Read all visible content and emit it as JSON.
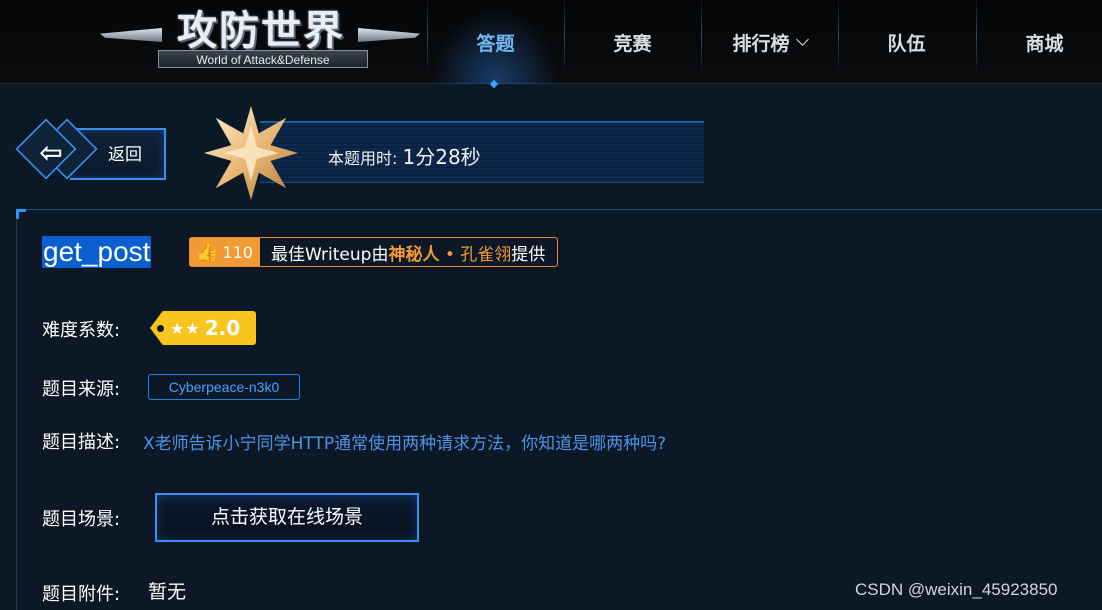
{
  "brand": {
    "logo_main": "攻防世界",
    "logo_sub": "World of Attack&Defense"
  },
  "nav": {
    "items": [
      {
        "label": "答题",
        "active": true
      },
      {
        "label": "竞赛",
        "active": false
      },
      {
        "label": "排行榜",
        "active": false,
        "has_dropdown": true
      },
      {
        "label": "队伍",
        "active": false
      },
      {
        "label": "商城",
        "active": false
      }
    ]
  },
  "back": {
    "label": "返回",
    "icon": "arrow-left-icon"
  },
  "timer": {
    "label": "本题用时:",
    "value": "1分28秒"
  },
  "challenge": {
    "title": "get_post",
    "writeup": {
      "likes": "110",
      "prefix": "最佳Writeup由",
      "author": "神秘人",
      "separator": "•",
      "translator": "孔雀翎",
      "suffix": "提供"
    },
    "difficulty": {
      "label": "难度系数:",
      "stars": "★★",
      "value": "2.0"
    },
    "source": {
      "label": "题目来源:",
      "value": "Cyberpeace-n3k0"
    },
    "description": {
      "label": "题目描述:",
      "value": "X老师告诉小宁同学HTTP通常使用两种请求方法，你知道是哪两种吗?"
    },
    "scene": {
      "label": "题目场景:",
      "button": "点击获取在线场景"
    },
    "attachment": {
      "label": "题目附件:",
      "value": "暂无"
    }
  },
  "watermark": "CSDN @weixin_45923850",
  "colors": {
    "accent": "#3c8ef0",
    "highlight": "#f29a33",
    "difficulty": "#f7c51e",
    "background": "#0b1826"
  }
}
